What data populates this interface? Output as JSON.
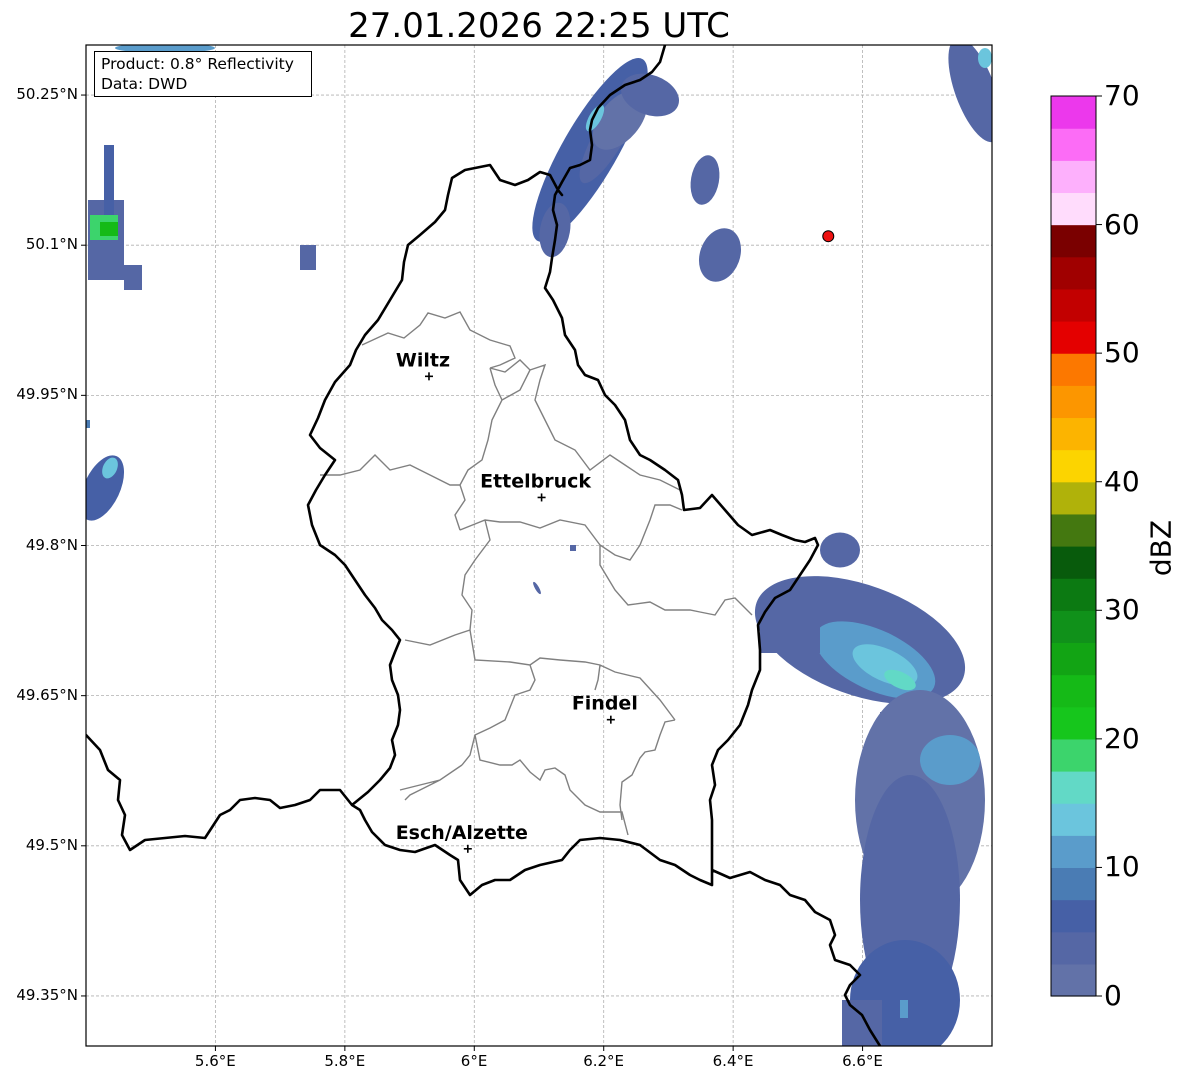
{
  "title": "27.01.2026 22:25 UTC",
  "info": {
    "product": "Product: 0.8° Reflectivity",
    "data": "Data: DWD"
  },
  "map": {
    "extent": {
      "lon": [
        5.4,
        6.8
      ],
      "lat": [
        49.3,
        50.3
      ]
    },
    "lat_ticks": [
      {
        "value": 50.25,
        "label": "50.25°N"
      },
      {
        "value": 50.1,
        "label": "50.1°N"
      },
      {
        "value": 49.95,
        "label": "49.95°N"
      },
      {
        "value": 49.8,
        "label": "49.8°N"
      },
      {
        "value": 49.65,
        "label": "49.65°N"
      },
      {
        "value": 49.5,
        "label": "49.5°N"
      },
      {
        "value": 49.35,
        "label": "49.35°N"
      }
    ],
    "lon_ticks": [
      {
        "value": 5.6,
        "label": "5.6°E"
      },
      {
        "value": 5.8,
        "label": "5.8°E"
      },
      {
        "value": 6.0,
        "label": "6°E"
      },
      {
        "value": 6.2,
        "label": "6.2°E"
      },
      {
        "value": 6.4,
        "label": "6.4°E"
      },
      {
        "value": 6.6,
        "label": "6.6°E"
      }
    ],
    "cities": [
      {
        "name": "Wiltz",
        "lon": 5.93,
        "lat": 49.969
      },
      {
        "name": "Ettelbruck",
        "lon": 6.104,
        "lat": 49.848
      },
      {
        "name": "Findel",
        "lon": 6.211,
        "lat": 49.626
      },
      {
        "name": "Esch/Alzette",
        "lon": 5.99,
        "lat": 49.497
      }
    ],
    "radar_site": {
      "lon": 6.547,
      "lat": 50.109,
      "color": "#ee1111"
    },
    "border_color": "#000000",
    "canton_color": "#808080"
  },
  "colorbar": {
    "label": "dBZ",
    "min": 0,
    "max": 70,
    "step": 2.5,
    "tick_values": [
      0,
      10,
      20,
      30,
      40,
      50,
      60,
      70
    ],
    "tick_labels": [
      "0",
      "10",
      "20",
      "30",
      "40",
      "50",
      "60",
      "70"
    ],
    "colors": [
      "#6272a8",
      "#5567a5",
      "#4660a6",
      "#4a7cb4",
      "#5a9ccb",
      "#6bc5dd",
      "#62d9c6",
      "#3cd46c",
      "#16c61c",
      "#15ba17",
      "#12a414",
      "#10911a",
      "#0c7a12",
      "#085b0c",
      "#447810",
      "#b0b20a",
      "#fcd400",
      "#fcb400",
      "#fc9600",
      "#fc7800",
      "#e40000",
      "#c20000",
      "#a00000",
      "#7a0000",
      "#ffdcfc",
      "#fdb0fc",
      "#fc6cf6",
      "#ec38ec"
    ]
  }
}
